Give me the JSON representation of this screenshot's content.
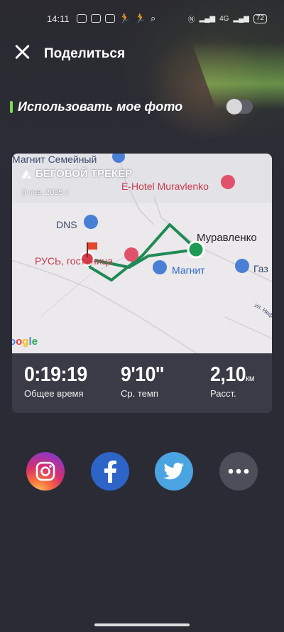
{
  "status_bar": {
    "time": "14:11",
    "battery": "72",
    "network": "4G"
  },
  "header": {
    "title": "Поделиться"
  },
  "photo_option": {
    "label": "Использовать мое фото",
    "enabled": false
  },
  "card": {
    "brand": "БЕГОВОЙ ТРЕКЕР",
    "date": "3 янв. 2025 г.",
    "map_labels": {
      "magnit_family": "Магнит Семейный",
      "hotel": "E-Hotel Muravlenko",
      "dns": "DNS",
      "city": "Муравленко",
      "rus": "РУСЬ, гостиница",
      "magnit": "Магнит",
      "gas": "Газ",
      "street": "ул. Неф",
      "google": "oogle"
    },
    "stats": {
      "time": {
        "value": "0:19:19",
        "label": "Общее время"
      },
      "pace": {
        "value": "9'10''",
        "label": "Ср. темп"
      },
      "distance": {
        "value": "2,10",
        "unit": "км",
        "label": "Расст."
      }
    }
  },
  "share": {
    "items": [
      {
        "name": "instagram",
        "icon": "instagram-icon",
        "color": "#d6306f"
      },
      {
        "name": "facebook",
        "icon": "facebook-icon",
        "color": "#2d64c8"
      },
      {
        "name": "twitter",
        "icon": "twitter-icon",
        "color": "#4aa4e2"
      },
      {
        "name": "more",
        "icon": "more-icon",
        "color": "#4e4e5a"
      }
    ]
  },
  "colors": {
    "accent": "#7ed957",
    "route": "#1f8a55",
    "background": "#2b2b36"
  }
}
